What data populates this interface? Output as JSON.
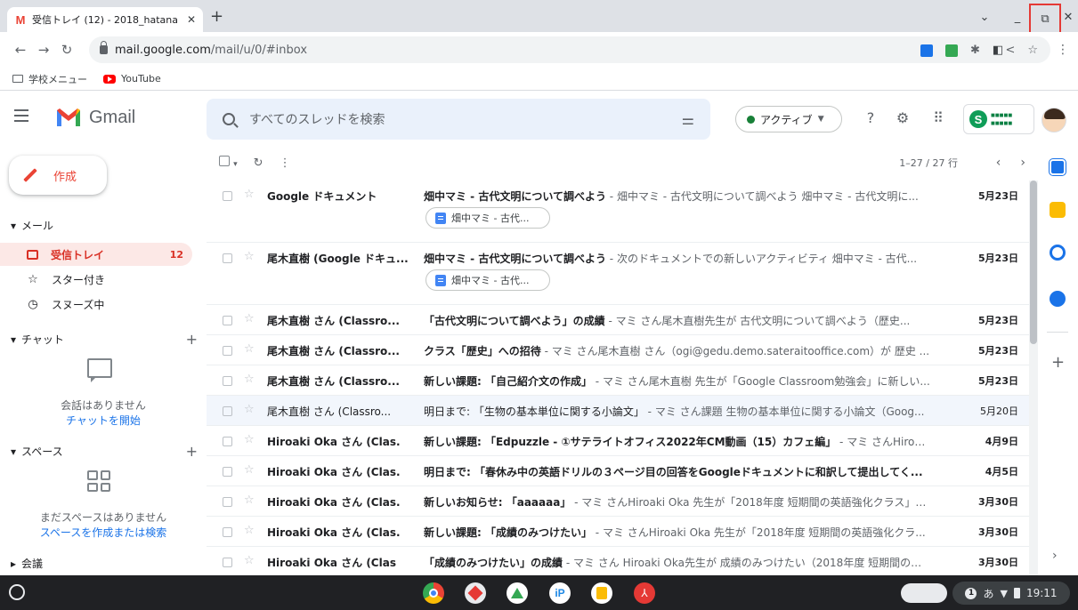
{
  "browser": {
    "tab_title": "受信トレイ (12) - 2018_hatana",
    "tab_favicon": "M",
    "tab_close": "✕",
    "new_tab": "+",
    "url_host": "mail.google.com",
    "url_path": "/mail/u/0/#inbox",
    "bookmarks": [
      {
        "label": "学校メニュー",
        "icon": "folder-icon"
      },
      {
        "label": "YouTube",
        "icon": "youtube-icon"
      }
    ]
  },
  "gmail": {
    "brand": "Gmail",
    "search_placeholder": "すべてのスレッドを検索",
    "status_label": "アクティブ",
    "status_color": "#188038",
    "accent_color": "#d93025"
  },
  "nav": {
    "compose": "作成",
    "mail_section": "メール",
    "items": [
      {
        "label": "受信トレイ",
        "count": "12",
        "icon": "inbox-icon"
      },
      {
        "label": "スター付き",
        "icon": "star-icon"
      },
      {
        "label": "スヌーズ中",
        "icon": "clock-icon"
      }
    ],
    "chat_section": "チャット",
    "chat_empty": "会話はありません",
    "chat_start": "チャットを開始",
    "spaces_section": "スペース",
    "spaces_empty": "まだスペースはありません",
    "spaces_link": "スペースを作成または検索",
    "meet_section": "会議"
  },
  "list": {
    "pager": "1–27 / 27 行",
    "rows": [
      {
        "sender": "Google ドキュメント",
        "subject": "畑中マミ - 古代文明について調べよう",
        "snippet": " - 畑中マミ - 古代文明について調べよう 畑中マミ - 古代文明に...",
        "date": "5月23日",
        "chip": "畑中マミ - 古代...",
        "read": false
      },
      {
        "sender": "尾木直樹 (Google ドキュ...",
        "subject": "畑中マミ - 古代文明について調べよう",
        "snippet": " - 次のドキュメントでの新しいアクティビティ 畑中マミ - 古代...",
        "date": "5月23日",
        "chip": "畑中マミ - 古代...",
        "read": false
      },
      {
        "sender": "尾木直樹 さん (Classro...",
        "subject": "「古代文明について調べよう」の成績",
        "snippet": " - マミ さん尾木直樹先生が 古代文明について調べよう（歴史...",
        "date": "5月23日",
        "read": false
      },
      {
        "sender": "尾木直樹 さん (Classro...",
        "subject": "クラス「歴史」への招待",
        "snippet": " - マミ さん尾木直樹 さん（ogi@gedu.demo.sateraitooffice.com）が 歴史 ...",
        "date": "5月23日",
        "read": false
      },
      {
        "sender": "尾木直樹 さん (Classro...",
        "subject": "新しい課題: 「自己紹介文の作成」",
        "snippet": " - マミ さん尾木直樹 先生が「Google Classroom勉強会」に新しい...",
        "date": "5月23日",
        "read": false
      },
      {
        "sender": "尾木直樹 さん (Classro...",
        "subject": "明日まで: 「生物の基本単位に関する小論文」",
        "snippet": " - マミ さん課題 生物の基本単位に関する小論文（Goog...",
        "date": "5月20日",
        "read": true
      },
      {
        "sender": "Hiroaki Oka さん (Clas.",
        "subject": "新しい課題: 「Edpuzzle - ①サテライトオフィス2022年CM動画（15）カフェ編」",
        "snippet": " - マミ さんHiroaki ...",
        "date": "4月9日",
        "read": false
      },
      {
        "sender": "Hiroaki Oka さん (Clas.",
        "subject": "明日まで: 「春休み中の英語ドリルの３ページ目の回答をGoogleドキュメントに和訳して提出してく...",
        "snippet": "",
        "date": "4月5日",
        "read": false
      },
      {
        "sender": "Hiroaki Oka さん (Clas.",
        "subject": "新しいお知らせ: 「aaaaaa」",
        "snippet": " - マミ さんHiroaki Oka 先生が「2018年度 短期間の英語強化クラス」に...",
        "date": "3月30日",
        "read": false
      },
      {
        "sender": "Hiroaki Oka さん (Clas.",
        "subject": "新しい課題: 「成績のみつけたい」",
        "snippet": " - マミ さんHiroaki Oka 先生が「2018年度 短期間の英語強化クラ...",
        "date": "3月30日",
        "read": false
      },
      {
        "sender": "Hiroaki Oka さん (Clas",
        "subject": "「成績のみつけたい」の成績",
        "snippet": " - マミ さん Hiroaki Oka先生が 成績のみつけたい（2018年度 短期間の英...",
        "date": "3月30日",
        "read": false
      }
    ]
  },
  "shelf": {
    "time": "19:11",
    "ime": "あ",
    "notification_count": "1",
    "acrobat_glyph": "⅄",
    "ip_glyph": "iP"
  }
}
